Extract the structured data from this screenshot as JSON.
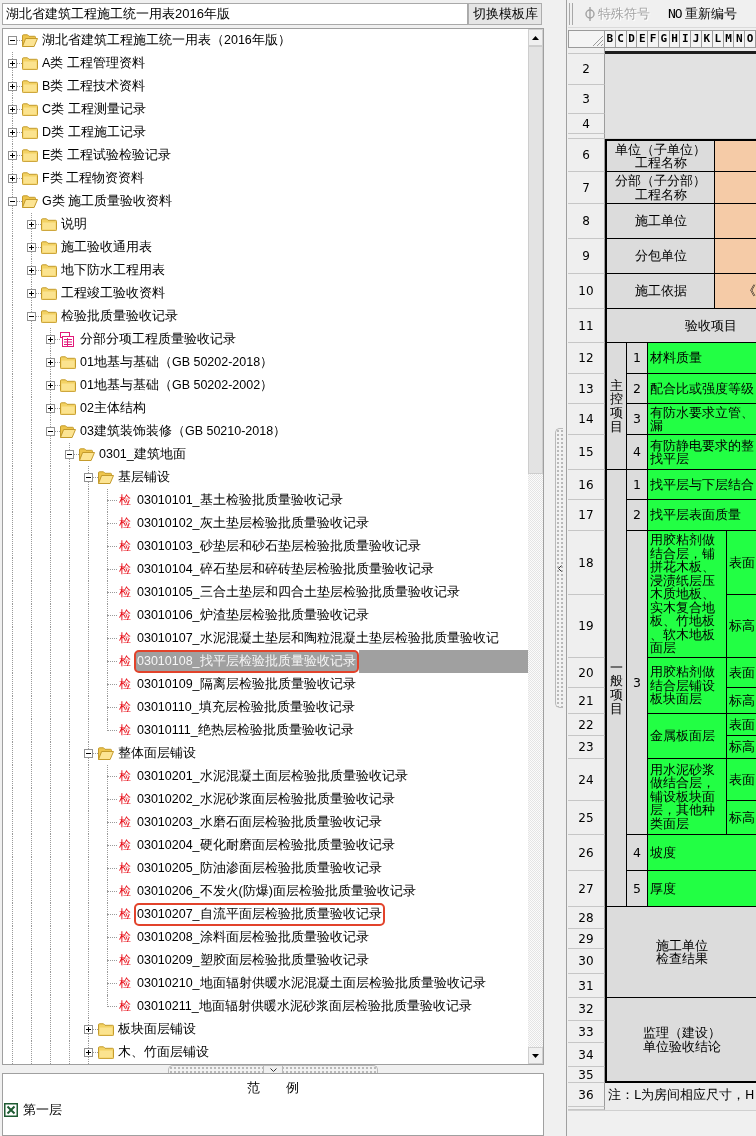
{
  "library_field": {
    "value": "湖北省建筑工程施工统一用表2016年版"
  },
  "switch_button": "切换模板库",
  "tree": {
    "label": "湖北省建筑工程施工统一用表（2016年版）",
    "kind": "openfolder",
    "expanded": true,
    "selected": false,
    "children": [
      {
        "label": "A类 工程管理资料",
        "kind": "folder",
        "expanded": false,
        "selected": false
      },
      {
        "label": "B类 工程技术资料",
        "kind": "folder",
        "expanded": false,
        "selected": false
      },
      {
        "label": "C类 工程测量记录",
        "kind": "folder",
        "expanded": false,
        "selected": false
      },
      {
        "label": "D类 工程施工记录",
        "kind": "folder",
        "expanded": false,
        "selected": false
      },
      {
        "label": "E类 工程试验检验记录",
        "kind": "folder",
        "expanded": false,
        "selected": false
      },
      {
        "label": "F类 工程物资资料",
        "kind": "folder",
        "expanded": false,
        "selected": false
      },
      {
        "label": "G类 施工质量验收资料",
        "kind": "openfolder",
        "expanded": true,
        "selected": false,
        "children": [
          {
            "label": "说明",
            "kind": "folder",
            "expanded": false,
            "selected": false
          },
          {
            "label": "施工验收通用表",
            "kind": "folder",
            "expanded": false,
            "selected": false
          },
          {
            "label": "地下防水工程用表",
            "kind": "folder",
            "expanded": false,
            "selected": false
          },
          {
            "label": "工程竣工验收资料",
            "kind": "folder",
            "expanded": false,
            "selected": false
          },
          {
            "label": "检验批质量验收记录",
            "kind": "folder",
            "expanded": true,
            "selected": false,
            "children": [
              {
                "label": "分部分项工程质量验收记录",
                "kind": "form",
                "expanded": false,
                "selected": false
              },
              {
                "label": "01地基与基础（GB 50202-2018）",
                "kind": "folder",
                "expanded": false,
                "selected": false
              },
              {
                "label": "01地基与基础（GB 50202-2002）",
                "kind": "folder",
                "expanded": false,
                "selected": false
              },
              {
                "label": "02主体结构",
                "kind": "folder",
                "expanded": false,
                "selected": false
              },
              {
                "label": "03建筑装饰装修（GB 50210-2018）",
                "kind": "openfolder",
                "expanded": true,
                "selected": false,
                "children": [
                  {
                    "label": "0301_建筑地面",
                    "kind": "openfolder",
                    "expanded": true,
                    "selected": false,
                    "children": [
                      {
                        "label": "基层铺设",
                        "kind": "openfolder",
                        "expanded": true,
                        "selected": false,
                        "children": [
                          {
                            "kind": "item",
                            "tag": "检",
                            "label": "03010101_基土检验批质量验收记录",
                            "selected": false,
                            "annotated": false
                          },
                          {
                            "kind": "item",
                            "tag": "检",
                            "label": "03010102_灰土垫层检验批质量验收记录",
                            "selected": false,
                            "annotated": false
                          },
                          {
                            "kind": "item",
                            "tag": "检",
                            "label": "03010103_砂垫层和砂石垫层检验批质量验收记录",
                            "selected": false,
                            "annotated": false
                          },
                          {
                            "kind": "item",
                            "tag": "检",
                            "label": "03010104_碎石垫层和碎砖垫层检验批质量验收记录",
                            "selected": false,
                            "annotated": false
                          },
                          {
                            "kind": "item",
                            "tag": "检",
                            "label": "03010105_三合土垫层和四合土垫层检验批质量验收记录",
                            "selected": false,
                            "annotated": false
                          },
                          {
                            "kind": "item",
                            "tag": "检",
                            "label": "03010106_炉渣垫层检验批质量验收记录",
                            "selected": false,
                            "annotated": false
                          },
                          {
                            "kind": "item",
                            "tag": "检",
                            "label": "03010107_水泥混凝土垫层和陶粒混凝土垫层检验批质量验收记",
                            "selected": false,
                            "annotated": false
                          },
                          {
                            "kind": "item",
                            "tag": "检",
                            "label": "03010108_找平层检验批质量验收记录",
                            "selected": true,
                            "annotated": true
                          },
                          {
                            "kind": "item",
                            "tag": "检",
                            "label": "03010109_隔离层检验批质量验收记录",
                            "selected": false,
                            "annotated": false
                          },
                          {
                            "kind": "item",
                            "tag": "检",
                            "label": "03010110_填充层检验批质量验收记录",
                            "selected": false,
                            "annotated": false
                          },
                          {
                            "kind": "item",
                            "tag": "检",
                            "label": "03010111_绝热层检验批质量验收记录",
                            "selected": false,
                            "annotated": false
                          }
                        ]
                      },
                      {
                        "label": "整体面层铺设",
                        "kind": "openfolder",
                        "expanded": true,
                        "selected": false,
                        "children": [
                          {
                            "kind": "item",
                            "tag": "检",
                            "label": "03010201_水泥混凝土面层检验批质量验收记录",
                            "selected": false,
                            "annotated": false
                          },
                          {
                            "kind": "item",
                            "tag": "检",
                            "label": "03010202_水泥砂浆面层检验批质量验收记录",
                            "selected": false,
                            "annotated": false
                          },
                          {
                            "kind": "item",
                            "tag": "检",
                            "label": "03010203_水磨石面层检验批质量验收记录",
                            "selected": false,
                            "annotated": false
                          },
                          {
                            "kind": "item",
                            "tag": "检",
                            "label": "03010204_硬化耐磨面层检验批质量验收记录",
                            "selected": false,
                            "annotated": false
                          },
                          {
                            "kind": "item",
                            "tag": "检",
                            "label": "03010205_防油渗面层检验批质量验收记录",
                            "selected": false,
                            "annotated": false
                          },
                          {
                            "kind": "item",
                            "tag": "检",
                            "label": "03010206_不发火(防爆)面层检验批质量验收记录",
                            "selected": false,
                            "annotated": false
                          },
                          {
                            "kind": "item",
                            "tag": "检",
                            "label": "03010207_自流平面层检验批质量验收记录",
                            "selected": false,
                            "annotated": true
                          },
                          {
                            "kind": "item",
                            "tag": "检",
                            "label": "03010208_涂料面层检验批质量验收记录",
                            "selected": false,
                            "annotated": false
                          },
                          {
                            "kind": "item",
                            "tag": "检",
                            "label": "03010209_塑胶面层检验批质量验收记录",
                            "selected": false,
                            "annotated": false
                          },
                          {
                            "kind": "item",
                            "tag": "检",
                            "label": "03010210_地面辐射供暖水泥混凝土面层检验批质量验收记录",
                            "selected": false,
                            "annotated": false
                          },
                          {
                            "kind": "item",
                            "tag": "检",
                            "label": "03010211_地面辐射供暖水泥砂浆面层检验批质量验收记录",
                            "selected": false,
                            "annotated": false
                          }
                        ]
                      },
                      {
                        "label": "板块面层铺设",
                        "kind": "folder",
                        "expanded": false,
                        "selected": false
                      },
                      {
                        "label": "木、竹面层铺设",
                        "kind": "folder",
                        "expanded": false,
                        "selected": false
                      }
                    ]
                  }
                ]
              }
            ]
          }
        ]
      }
    ]
  },
  "legend": {
    "title": "范　　例",
    "items": [
      {
        "label": "第一层"
      }
    ]
  },
  "toolbar": [
    {
      "kind": "symbol",
      "label": "特殊符号",
      "disabled": true
    },
    {
      "kind": "numbering",
      "glyph": "NO",
      "label": "重新编号",
      "disabled": false
    }
  ],
  "sheet": {
    "columns": [
      "B",
      "C",
      "D",
      "E",
      "F",
      "G",
      "H",
      "I",
      "J",
      "K",
      "L",
      "M",
      "N",
      "O"
    ],
    "row_numbers": [
      "2",
      "3",
      "4",
      "6",
      "7",
      "8",
      "9",
      "10",
      "11",
      "12",
      "13",
      "14",
      "15",
      "16",
      "17",
      "18",
      "19",
      "20",
      "21",
      "22",
      "23",
      "24",
      "25",
      "26",
      "27",
      "28",
      "29",
      "30",
      "31",
      "32",
      "33",
      "34",
      "35",
      "36"
    ]
  },
  "form": {
    "fields": [
      {
        "label": [
          "单位（子单位）",
          "工程名称"
        ]
      },
      {
        "label": [
          "分部（子分部）",
          "工程名称"
        ]
      },
      {
        "label": [
          "施工单位"
        ]
      },
      {
        "label": [
          "分包单位"
        ]
      },
      {
        "label": [
          "施工依据"
        ],
        "value": "《"
      }
    ],
    "section_title": "验收项目",
    "groups": [
      {
        "title": "主控项目",
        "items": [
          {
            "number": "1",
            "text": [
              "材料质量"
            ]
          },
          {
            "number": "2",
            "text": [
              "配合比或强度等级"
            ]
          },
          {
            "number": "3",
            "text": [
              "有防水要求立管、",
              "漏"
            ]
          },
          {
            "number": "4",
            "text": [
              "有防静电要求的整",
              "找平层"
            ]
          }
        ]
      },
      {
        "title": "一般项目",
        "items": [
          {
            "number": "1",
            "text": [
              "找平层与下层结合"
            ]
          },
          {
            "number": "2",
            "text": [
              "找平层表面质量"
            ]
          },
          {
            "number": "3",
            "subitems": [
              {
                "text": [
                  "用胶粘剂做",
                  "结合层，铺",
                  "拼花木板、",
                  "浸渍纸层压",
                  "木质地板、",
                  "实木复合地",
                  "板、竹地板",
                  "、软木地板",
                  "面层"
                ],
                "checks": [
                  "表面",
                  "标高"
                ]
              },
              {
                "text": [
                  "用胶粘剂做",
                  "结合层铺设",
                  "板块面层"
                ],
                "checks": [
                  "表面",
                  "标高"
                ]
              },
              {
                "text": [
                  "金属板面层"
                ],
                "checks": [
                  "表面",
                  "标高"
                ]
              },
              {
                "text": [
                  "用水泥砂浆",
                  "做结合层，",
                  "铺设板块面",
                  "层，其他种",
                  "类面层"
                ],
                "checks": [
                  "表面",
                  "标高"
                ]
              }
            ]
          },
          {
            "number": "4",
            "text": [
              "坡度"
            ]
          },
          {
            "number": "5",
            "text": [
              "厚度"
            ]
          }
        ]
      }
    ],
    "results": [
      {
        "label": [
          "施工单位",
          "检查结果"
        ]
      },
      {
        "label": [
          "监理（建设）",
          "单位验收结论"
        ]
      }
    ],
    "note": "注：L为房间相应尺寸，H"
  }
}
